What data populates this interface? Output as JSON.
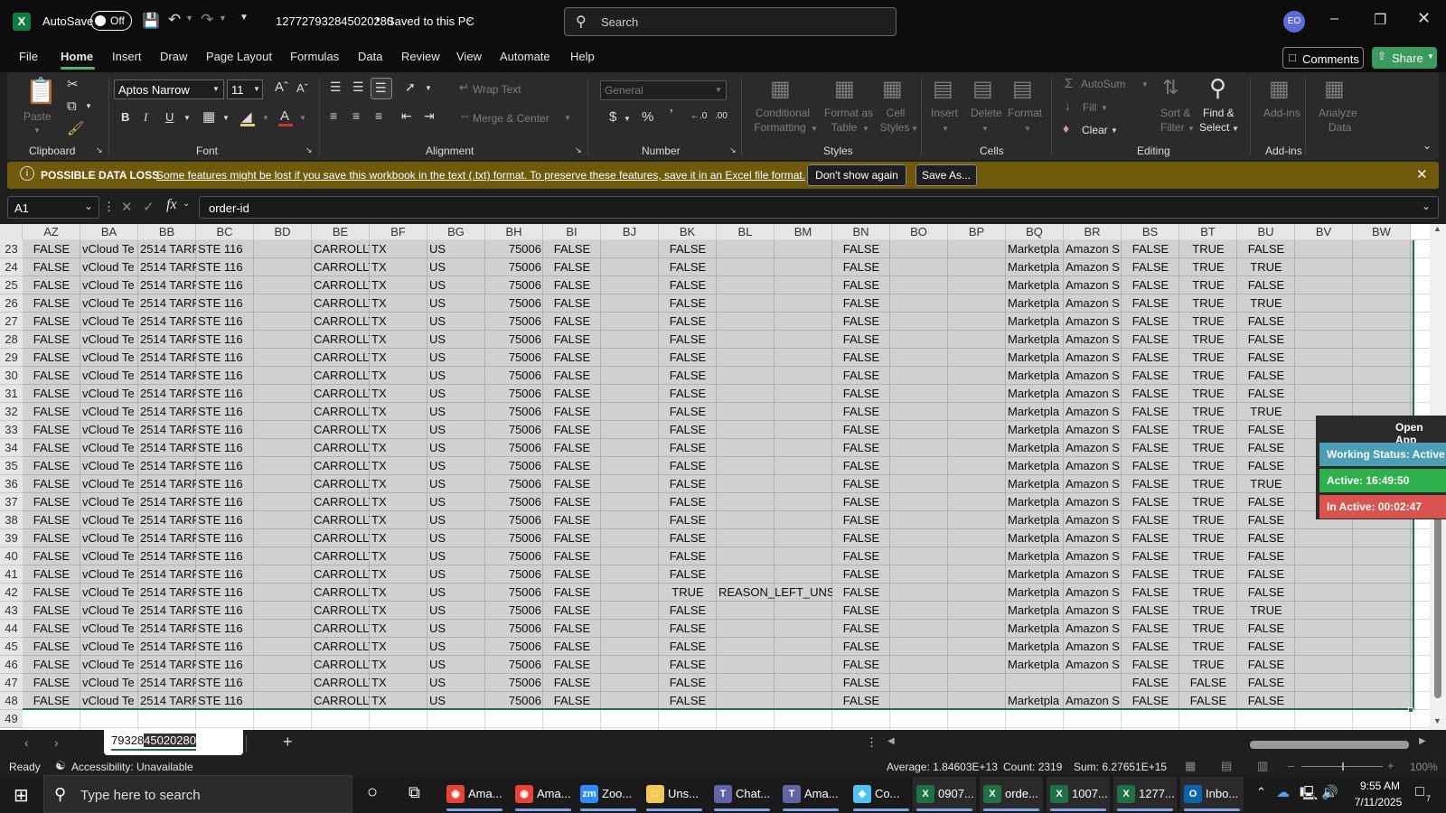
{
  "titlebar": {
    "autosave_label": "AutoSave",
    "toggle_label": "Off",
    "filename": "127727932845020280",
    "saved_status": "Saved to this PC",
    "search_placeholder": "Search",
    "avatar": "EO"
  },
  "menu": [
    "File",
    "Home",
    "Insert",
    "Draw",
    "Page Layout",
    "Formulas",
    "Data",
    "Review",
    "View",
    "Automate",
    "Help"
  ],
  "menu_right": {
    "comments": "Comments",
    "share": "Share"
  },
  "ribbon": {
    "clipboard": {
      "paste": "Paste",
      "group": "Clipboard"
    },
    "font": {
      "name": "Aptos Narrow",
      "size": "11",
      "group": "Font"
    },
    "alignment": {
      "wrap": "Wrap Text",
      "merge": "Merge & Center",
      "group": "Alignment"
    },
    "number": {
      "format": "General",
      "group": "Number"
    },
    "styles": {
      "conditional1": "Conditional",
      "conditional2": "Formatting",
      "format_table1": "Format as",
      "format_table2": "Table",
      "cell_styles1": "Cell",
      "cell_styles2": "Styles",
      "group": "Styles"
    },
    "cells": {
      "insert": "Insert",
      "delete": "Delete",
      "format": "Format",
      "group": "Cells"
    },
    "editing": {
      "autosum": "AutoSum",
      "fill": "Fill",
      "clear": "Clear",
      "sort1": "Sort &",
      "sort2": "Filter",
      "find1": "Find &",
      "find2": "Select",
      "group": "Editing"
    },
    "addins": {
      "addins1": "Add-ins",
      "addins2": "Add-ins",
      "analyze1": "Analyze",
      "analyze2": "Data",
      "group": "Add-ins"
    }
  },
  "banner": {
    "title": "POSSIBLE DATA LOSS",
    "message": "Some features might be lost if you save this workbook in the text (.txt) format. To preserve these features, save it in an Excel file format.",
    "dont_show": "Don't show again",
    "save_as": "Save As..."
  },
  "formula_bar": {
    "name_box": "A1",
    "fx": "fx",
    "content": "order-id"
  },
  "columns": [
    "AZ",
    "BA",
    "BB",
    "BC",
    "BD",
    "BE",
    "BF",
    "BG",
    "BH",
    "BI",
    "BJ",
    "BK",
    "BL",
    "BM",
    "BN",
    "BO",
    "BP",
    "BQ",
    "BR",
    "BS",
    "BT",
    "BU",
    "BV",
    "BW"
  ],
  "row_numbers": [
    "23",
    "24",
    "25",
    "26",
    "27",
    "28",
    "29",
    "30",
    "31",
    "32",
    "33",
    "34",
    "35",
    "36",
    "37",
    "38",
    "39",
    "40",
    "41",
    "42",
    "43",
    "44",
    "45",
    "46",
    "47",
    "48",
    "49"
  ],
  "common": {
    "az": "FALSE",
    "ba": "vCloud Te",
    "bb": "2514 TARP",
    "bc": "STE 116",
    "be": "CARROLLT",
    "bf": "TX",
    "bg": "US",
    "bh": "75006",
    "bi": "FALSE",
    "bn": "FALSE",
    "bq": "Marketpla",
    "br": "Amazon S",
    "bs": "FALSE",
    "true": "TRUE"
  },
  "rows": [
    {
      "bk": "FALSE",
      "bl": "",
      "bq": "Marketpla",
      "br": "Amazon S",
      "bt": "TRUE",
      "bu": "FALSE"
    },
    {
      "bk": "FALSE",
      "bl": "",
      "bq": "Marketpla",
      "br": "Amazon S",
      "bt": "TRUE",
      "bu": "TRUE"
    },
    {
      "bk": "FALSE",
      "bl": "",
      "bq": "Marketpla",
      "br": "Amazon S",
      "bt": "TRUE",
      "bu": "FALSE"
    },
    {
      "bk": "FALSE",
      "bl": "",
      "bq": "Marketpla",
      "br": "Amazon S",
      "bt": "TRUE",
      "bu": "TRUE"
    },
    {
      "bk": "FALSE",
      "bl": "",
      "bq": "Marketpla",
      "br": "Amazon S",
      "bt": "TRUE",
      "bu": "FALSE"
    },
    {
      "bk": "FALSE",
      "bl": "",
      "bq": "Marketpla",
      "br": "Amazon S",
      "bt": "TRUE",
      "bu": "FALSE"
    },
    {
      "bk": "FALSE",
      "bl": "",
      "bq": "Marketpla",
      "br": "Amazon S",
      "bt": "TRUE",
      "bu": "FALSE"
    },
    {
      "bk": "FALSE",
      "bl": "",
      "bq": "Marketpla",
      "br": "Amazon S",
      "bt": "TRUE",
      "bu": "FALSE"
    },
    {
      "bk": "FALSE",
      "bl": "",
      "bq": "Marketpla",
      "br": "Amazon S",
      "bt": "TRUE",
      "bu": "FALSE"
    },
    {
      "bk": "FALSE",
      "bl": "",
      "bq": "Marketpla",
      "br": "Amazon S",
      "bt": "TRUE",
      "bu": "TRUE"
    },
    {
      "bk": "FALSE",
      "bl": "",
      "bq": "Marketpla",
      "br": "Amazon S",
      "bt": "TRUE",
      "bu": "FALSE"
    },
    {
      "bk": "FALSE",
      "bl": "",
      "bq": "Marketpla",
      "br": "Amazon S",
      "bt": "TRUE",
      "bu": "FALSE"
    },
    {
      "bk": "FALSE",
      "bl": "",
      "bq": "Marketpla",
      "br": "Amazon S",
      "bt": "TRUE",
      "bu": "FALSE"
    },
    {
      "bk": "FALSE",
      "bl": "",
      "bq": "Marketpla",
      "br": "Amazon S",
      "bt": "TRUE",
      "bu": "TRUE"
    },
    {
      "bk": "FALSE",
      "bl": "",
      "bq": "Marketpla",
      "br": "Amazon S",
      "bt": "TRUE",
      "bu": "FALSE"
    },
    {
      "bk": "FALSE",
      "bl": "",
      "bq": "Marketpla",
      "br": "Amazon S",
      "bt": "TRUE",
      "bu": "FALSE"
    },
    {
      "bk": "FALSE",
      "bl": "",
      "bq": "Marketpla",
      "br": "Amazon S",
      "bt": "TRUE",
      "bu": "FALSE"
    },
    {
      "bk": "FALSE",
      "bl": "",
      "bq": "Marketpla",
      "br": "Amazon S",
      "bt": "TRUE",
      "bu": "FALSE"
    },
    {
      "bk": "FALSE",
      "bl": "",
      "bq": "Marketpla",
      "br": "Amazon S",
      "bt": "TRUE",
      "bu": "FALSE"
    },
    {
      "bk": "TRUE",
      "bl": "REASON_LEFT_UNSPI",
      "bq": "Marketpla",
      "br": "Amazon S",
      "bt": "TRUE",
      "bu": "FALSE"
    },
    {
      "bk": "FALSE",
      "bl": "",
      "bq": "Marketpla",
      "br": "Amazon S",
      "bt": "TRUE",
      "bu": "TRUE"
    },
    {
      "bk": "FALSE",
      "bl": "",
      "bq": "Marketpla",
      "br": "Amazon S",
      "bt": "TRUE",
      "bu": "FALSE"
    },
    {
      "bk": "FALSE",
      "bl": "",
      "bq": "Marketpla",
      "br": "Amazon S",
      "bt": "TRUE",
      "bu": "FALSE"
    },
    {
      "bk": "FALSE",
      "bl": "",
      "bq": "Marketpla",
      "br": "Amazon S",
      "bt": "TRUE",
      "bu": "FALSE"
    },
    {
      "bk": "FALSE",
      "bl": "",
      "bq": "",
      "br": "",
      "bt": "FALSE",
      "bu": "FALSE"
    },
    {
      "bk": "FALSE",
      "bl": "",
      "bq": "Marketpla",
      "br": "Amazon S",
      "bt": "FALSE",
      "bu": "FALSE"
    }
  ],
  "overlay": {
    "open_app": "Open App",
    "working": "Working Status: Active",
    "active": "Active: 16:49:50",
    "inactive": "In Active: 00:02:47"
  },
  "sheet": {
    "tab_name_prefix": "79328",
    "tab_name_selected": "45020280",
    "add": "+"
  },
  "status": {
    "ready": "Ready",
    "accessibility": "Accessibility: Unavailable",
    "average": "Average: 1.84603E+13",
    "count": "Count: 2319",
    "sum": "Sum: 6.27651E+15",
    "zoom": "100%"
  },
  "taskbar": {
    "search": "Type here to search",
    "apps": [
      "Ama...",
      "Ama...",
      "Zoo...",
      "Uns...",
      "Chat...",
      "Ama...",
      "Co...",
      "0907...",
      "orde...",
      "1007...",
      "1277...",
      "Inbo..."
    ],
    "time": "9:55 AM",
    "date": "7/11/2025",
    "notif": "7"
  },
  "colors": {
    "accent": "#107c41",
    "banner": "#6e5a0a",
    "working": "#4a9fb5",
    "active": "#2eb04c",
    "inactive": "#d9534f"
  }
}
